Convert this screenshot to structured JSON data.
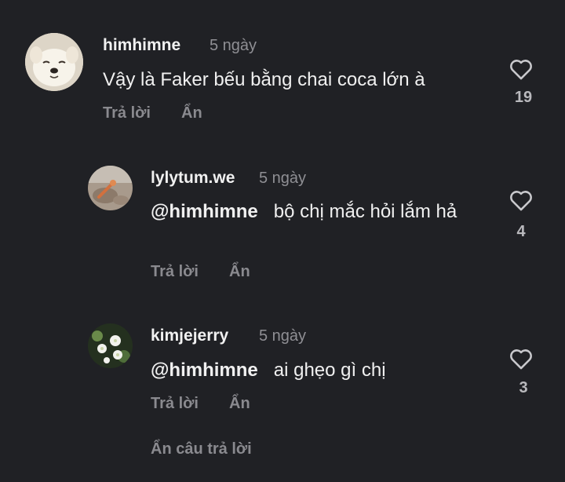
{
  "comments": [
    {
      "username": "himhimne",
      "time": "5 ngày",
      "mention": "",
      "text": "Vậy là Faker bếu bằng chai coca lớn à",
      "likes": "19",
      "reply_label": "Trả lời",
      "hide_label": "Ẩn",
      "avatar_icon": "dog-avatar"
    },
    {
      "username": "lylytum.we",
      "time": "5 ngày",
      "mention": "@himhimne",
      "text": "bộ chị mắc hỏi lắm hả",
      "likes": "4",
      "reply_label": "Trả lời",
      "hide_label": "Ẩn",
      "avatar_icon": "photo-avatar"
    },
    {
      "username": "kimjejerry",
      "time": "5 ngày",
      "mention": "@himhimne",
      "text": "ai ghẹo gì chị",
      "likes": "3",
      "reply_label": "Trả lời",
      "hide_label": "Ẩn",
      "avatar_icon": "flower-avatar"
    }
  ],
  "hide_replies_label": "Ẩn câu trả lời",
  "colors": {
    "background": "#202125",
    "text": "#f0f0f0",
    "muted": "#8a8a8f"
  }
}
